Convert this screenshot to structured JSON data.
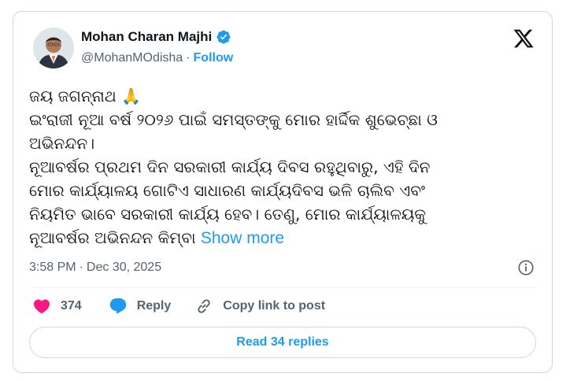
{
  "author": {
    "display_name": "Mohan Charan Majhi",
    "handle": "@MohanMOdisha",
    "separator": "·",
    "follow_label": "Follow"
  },
  "tweet": {
    "lines": [
      "ଜୟ ଜଗନ୍ନାଥ 🙏",
      "ଇଂରାଜୀ ନୂଆ ବର୍ଷ ୨୦୨୬ ପାଇଁ ସମସ୍ତଙ୍କୁ ମୋର ହାର୍ଦ୍ଦିକ ଶୁଭେଚ୍ଛା ଓ",
      "ଅଭିନନ୍ଦନ।",
      "ନୂଆବର୍ଷର ପ୍ରଥମ ଦିନ ସରକାରୀ କାର୍ଯ୍ୟ ଦିବସ ରହୁଥିବାରୁ, ଏହି ଦିନ",
      "ମୋର କାର୍ଯ୍ୟାଳୟ ଗୋଟିଏ ସାଧାରଣ କାର୍ଯ୍ୟଦିବସ ଭଳି ଚାଲିବ ଏବଂ",
      "ନିୟମିତ ଭାବେ ସରକାରୀ କାର୍ଯ୍ୟ ହେବ। ତେଣୁ, ମୋର କାର୍ଯ୍ୟାଳୟକୁ",
      "ନୂଆବର୍ଷର ଅଭିନନ୍ଦନ କିମ୍ବା"
    ],
    "show_more_label": "Show more"
  },
  "meta": {
    "time": "3:58 PM",
    "separator": "·",
    "date": "Dec 30, 2025"
  },
  "actions": {
    "like_count": "374",
    "reply_label": "Reply",
    "copy_label": "Copy link to post"
  },
  "read_replies_label": "Read 34 replies",
  "colors": {
    "accent": "#1d9bf0",
    "like": "#f91880",
    "muted": "#536471",
    "border": "#cfd9de"
  }
}
